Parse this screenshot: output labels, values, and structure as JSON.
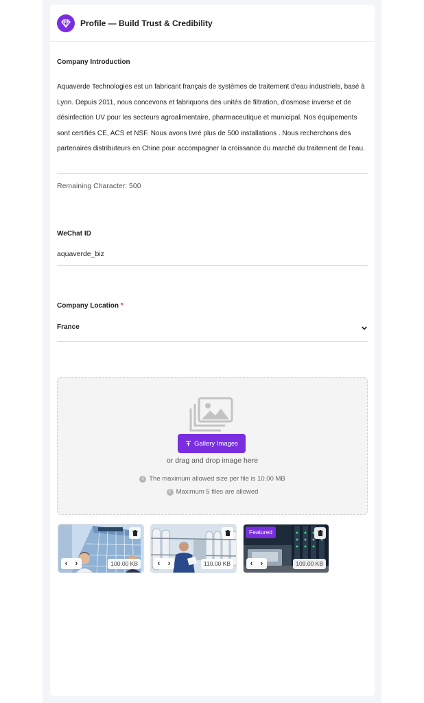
{
  "header": {
    "title": "Profile — Build Trust & Credibility",
    "icon": "diamond-icon",
    "accent": "#7a2ee0"
  },
  "intro": {
    "label": "Company Introduction",
    "text": "Aquaverde Technologies est un fabricant français de systèmes de traitement d'eau industriels, basé à Lyon. Depuis 2011, nous concevons et fabriquons des unités de filtration, d'osmose inverse et de désinfection UV pour les secteurs agroalimentaire, pharmaceutique et municipal. Nos équipements sont certifiés CE, ACS et NSF. Nous avons livré plus de 500 installations . Nous recherchons des partenaires distributeurs en Chine pour accompagner la croissance du marché du traitement de l'eau.",
    "remaining": "Remaining Character: 500"
  },
  "wechat": {
    "label": "WeChat ID",
    "value": "aquaverde_biz"
  },
  "location": {
    "label": "Company Location",
    "required_mark": "*",
    "value": "France"
  },
  "upload": {
    "button_label": "Gallery Images",
    "drag_text": "or drag and drop image here",
    "max_size_note": "The maximum allowed size per file is 10.00 MB",
    "max_files_note": "Maximum 5 files are allowed"
  },
  "gallery": [
    {
      "size": "100.00 KB",
      "featured": "",
      "scene": "office building"
    },
    {
      "size": "110.00 KB",
      "featured": "",
      "scene": "water treatment plant"
    },
    {
      "size": "109.00 KB",
      "featured": "Featured",
      "scene": "industrial machinery"
    }
  ]
}
